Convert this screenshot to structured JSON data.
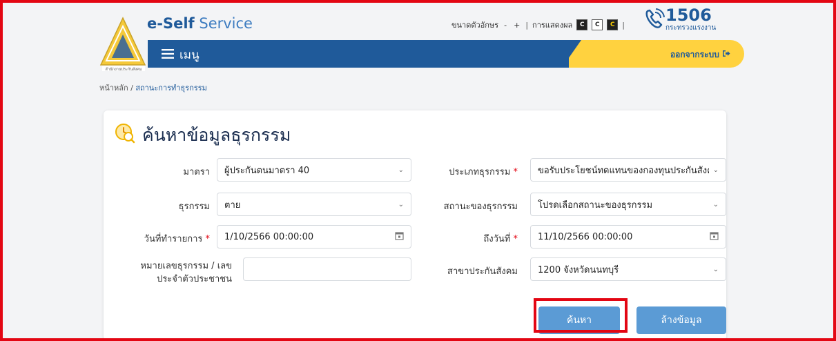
{
  "header": {
    "logo_caption": "สำนักงานประกันสังคม",
    "brand_bold": "e-Self",
    "brand_light": "Service",
    "font_size_label": "ขนาดตัวอักษร",
    "font_minus": "-",
    "font_plus": "+",
    "display_label": "การแสดงผล",
    "theme_dark": "C",
    "theme_light": "C",
    "theme_contrast": "C",
    "hotline_number": "1506",
    "hotline_sub": "กระทรวงแรงงาน",
    "menu_label": "เมนู",
    "logout_label": "ออกจากระบบ"
  },
  "breadcrumb": {
    "home": "หน้าหลัก",
    "separator": " / ",
    "current": "สถานะการทำธุรกรรม"
  },
  "form": {
    "title": "ค้นหาข้อมูลธุรกรรม",
    "section_label": "มาตรา",
    "section_value": "ผู้ประกันตนมาตรา 40",
    "txn_type_label": "ประเภทธุรกรรม",
    "txn_type_value": "ขอรับประโยชน์ทดแทนของกองทุนประกันสังคม",
    "txn_label": "ธุรกรรม",
    "txn_value": "ตาย",
    "status_label": "สถานะของธุรกรรม",
    "status_value": "โปรดเลือกสถานะของธุรกรรม",
    "date_from_label": "วันที่ทำรายการ",
    "date_from_value": "1/10/2566 00:00:00",
    "date_to_label": "ถึงวันที่",
    "date_to_value": "11/10/2566 00:00:00",
    "id_label_line1": "หมายเลขธุรกรรม / เลข",
    "id_label_line2": "ประจำตัวประชาชน",
    "id_value": "",
    "branch_label": "สาขาประกันสังคม",
    "branch_value": "1200 จังหวัดนนทบุรี",
    "required_mark": "*",
    "search_button": "ค้นหา",
    "clear_button": "ล้างข้อมูล"
  },
  "colors": {
    "primary": "#1f5a9a",
    "accent": "#ffd23f",
    "button": "#5b9bd5",
    "highlight": "#e30613"
  }
}
